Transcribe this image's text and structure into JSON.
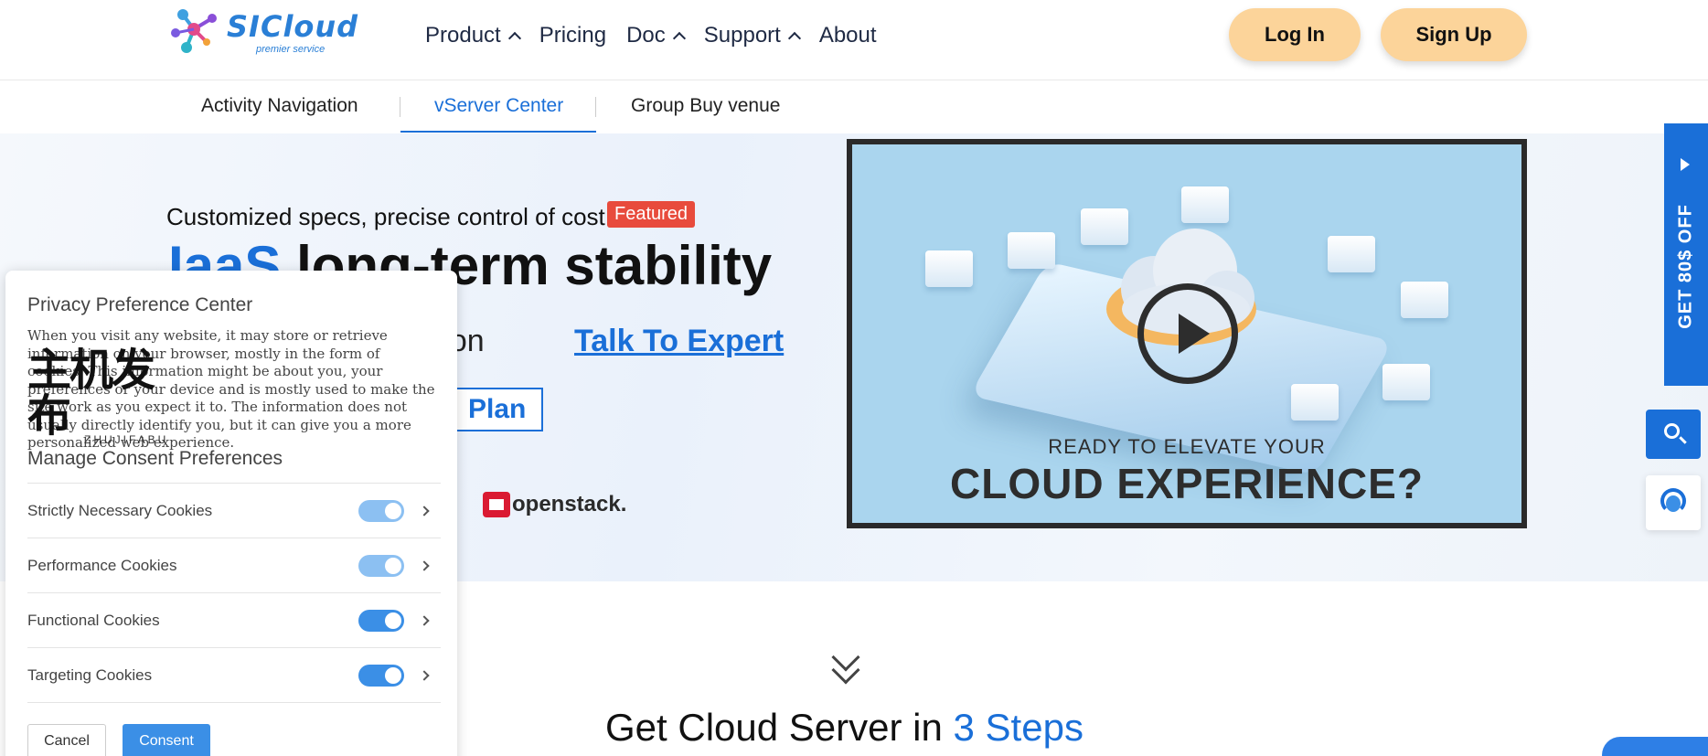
{
  "header": {
    "logo_text": "SICloud",
    "logo_sub": "premier service",
    "nav": [
      {
        "label": "Product",
        "has_dropdown": true
      },
      {
        "label": "Pricing",
        "has_dropdown": false
      },
      {
        "label": "Doc",
        "has_dropdown": true
      },
      {
        "label": "Support",
        "has_dropdown": true
      },
      {
        "label": "About",
        "has_dropdown": false
      }
    ],
    "login_label": "Log In",
    "signup_label": "Sign Up"
  },
  "subnav": {
    "items": [
      "Activity Navigation",
      "vServer Center",
      "Group Buy venue"
    ],
    "active": "vServer Center"
  },
  "hero": {
    "tagline": "Customized specs, precise control of cost",
    "badge": "Featured",
    "title_prefix": "IaaS",
    "title_rest": "long-term stability",
    "consult_text": "ultation",
    "consult_link": "Talk To Expert",
    "plan_label": "Plan",
    "partner": "openstack."
  },
  "video": {
    "line1": "READY TO ELEVATE YOUR",
    "line2": "CLOUD EXPERIENCE?"
  },
  "promo": {
    "text": "GET 80$ OFF"
  },
  "steps": {
    "title_prefix": "Get Cloud Server in",
    "title_highlight": "3 Steps"
  },
  "cookie_panel": {
    "title": "Privacy Preference Center",
    "description": "When you visit any website, it may store or retrieve information on your browser, mostly in the form of cookies. This information might be about you, your preferences or your device and is mostly used to make the site work as you expect it to. The information does not usually directly identify you, but it can give you a more personalized web experience.",
    "watermark_main": "主机发布",
    "watermark_sub": "ZHUJIFABU",
    "manage_title": "Manage Consent Preferences",
    "rows": [
      {
        "label": "Strictly Necessary Cookies",
        "enabled": true
      },
      {
        "label": "Performance Cookies",
        "enabled": true
      },
      {
        "label": "Functional Cookies",
        "enabled": true
      },
      {
        "label": "Targeting Cookies",
        "enabled": true
      }
    ],
    "cancel_label": "Cancel",
    "consent_label": "Consent"
  },
  "colors": {
    "brand_blue": "#1a6fd8",
    "button_peach": "#fcd49a",
    "featured_red": "#e84b3c",
    "toggle_blue": "#3b8fe6"
  }
}
